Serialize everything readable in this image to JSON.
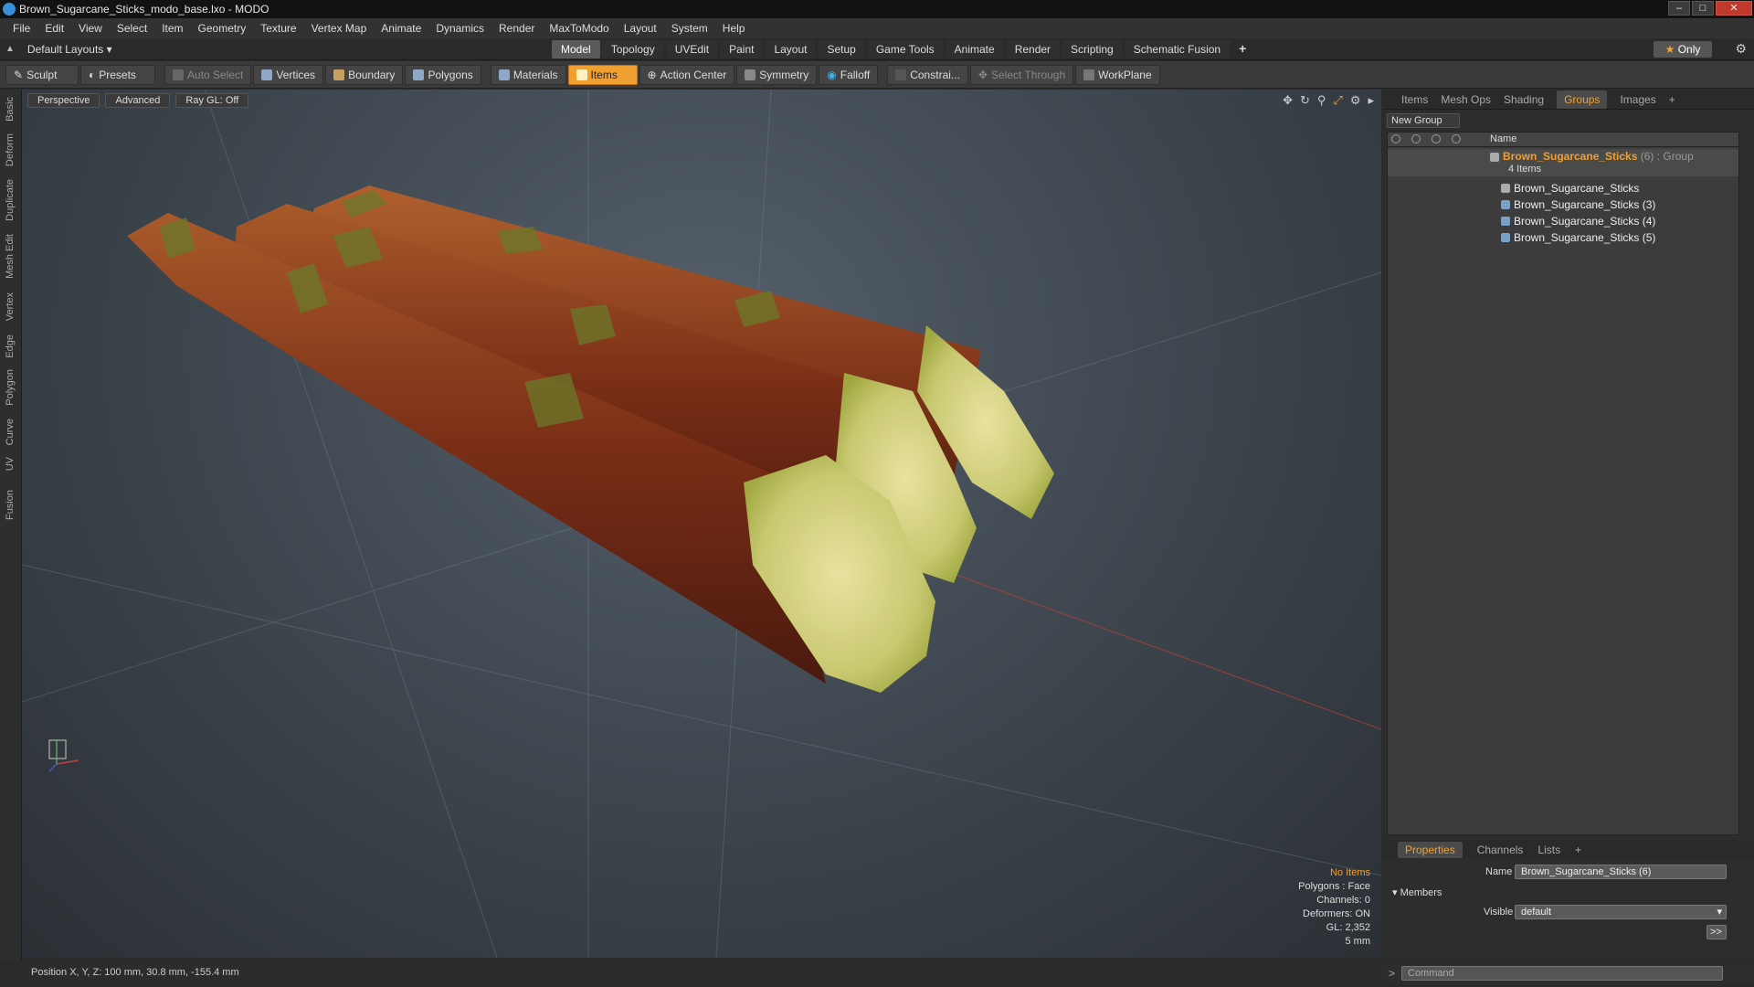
{
  "window": {
    "title": "Brown_Sugarcane_Sticks_modo_base.lxo - MODO"
  },
  "menu": [
    "File",
    "Edit",
    "View",
    "Select",
    "Item",
    "Geometry",
    "Texture",
    "Vertex Map",
    "Animate",
    "Dynamics",
    "Render",
    "MaxToModo",
    "Layout",
    "System",
    "Help"
  ],
  "layout_select": "Default Layouts",
  "layout_tabs": [
    "Model",
    "Topology",
    "UVEdit",
    "Paint",
    "Layout",
    "Setup",
    "Game Tools",
    "Animate",
    "Render",
    "Scripting",
    "Schematic Fusion"
  ],
  "only_label": "Only",
  "toolbar": {
    "sculpt": "Sculpt",
    "presets": "Presets",
    "auto_select": "Auto Select",
    "vertices": "Vertices",
    "boundary": "Boundary",
    "polygons": "Polygons",
    "materials": "Materials",
    "items": "Items",
    "action_center": "Action Center",
    "symmetry": "Symmetry",
    "falloff": "Falloff",
    "constrain": "Constrai...",
    "select_through": "Select Through",
    "workplane": "WorkPlane"
  },
  "left_tabs": [
    "Basic",
    "Deform",
    "Duplicate",
    "Mesh Edit",
    "Vertex",
    "Edge",
    "Polygon",
    "Curve",
    "UV",
    "Fusion"
  ],
  "viewport": {
    "perspective": "Perspective",
    "advanced": "Advanced",
    "raygl": "Ray GL: Off",
    "info": {
      "no_items": "No Items",
      "polygons": "Polygons : Face",
      "channels": "Channels: 0",
      "deformers": "Deformers: ON",
      "gl": "GL: 2,352",
      "scale": "5 mm"
    }
  },
  "status": "Position X, Y, Z:  100 mm, 30.8 mm, -155.4 mm",
  "right_tabs": [
    "Items",
    "Mesh Ops",
    "Shading",
    "Groups",
    "Images"
  ],
  "groups": {
    "new_group": "New Group",
    "name_header": "Name",
    "group_name": "Brown_Sugarcane_Sticks",
    "group_meta": "(6) : Group",
    "item_count": "4 Items",
    "items": [
      "Brown_Sugarcane_Sticks",
      "Brown_Sugarcane_Sticks (3)",
      "Brown_Sugarcane_Sticks (4)",
      "Brown_Sugarcane_Sticks (5)"
    ]
  },
  "properties": {
    "tabs": [
      "Properties",
      "Channels",
      "Lists"
    ],
    "name_label": "Name",
    "name_value": "Brown_Sugarcane_Sticks (6)",
    "members": "Members",
    "visible_label": "Visible",
    "visible_value": "default",
    "more": ">>"
  },
  "command_placeholder": "Command"
}
